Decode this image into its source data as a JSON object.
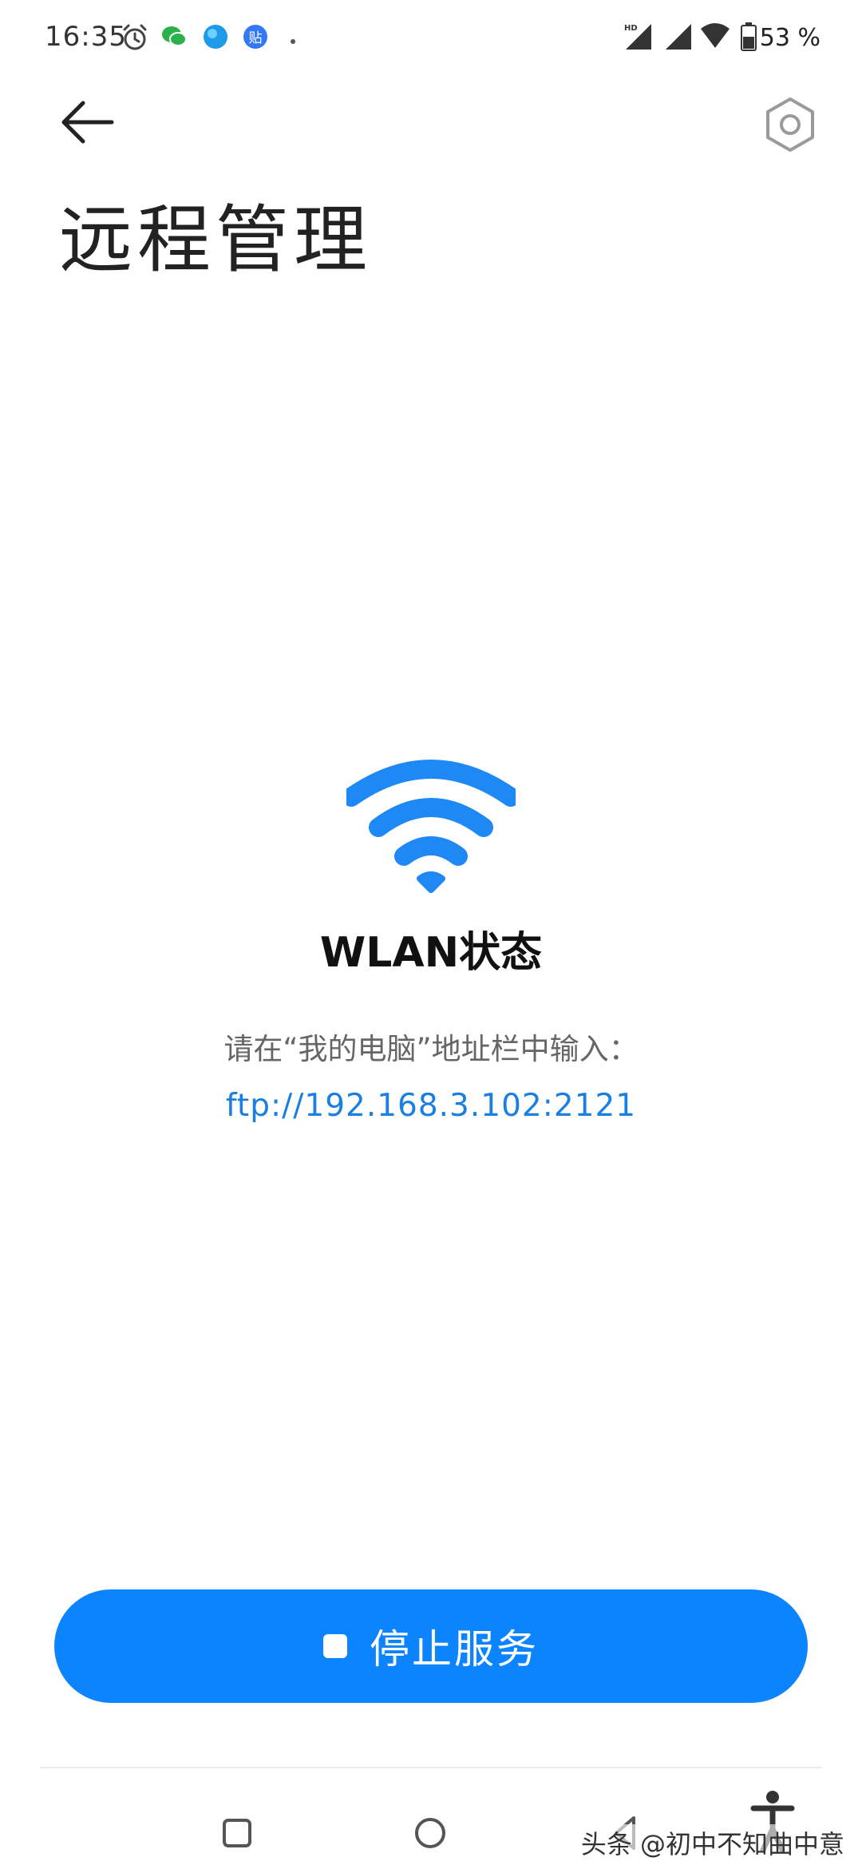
{
  "status_bar": {
    "time": "16:35",
    "battery_percent": "53 %",
    "notification_icons": [
      "alarm-icon",
      "wechat-icon",
      "browser-icon",
      "tieba-icon",
      "dot-icon"
    ],
    "system_icons": [
      "hd-signal-icon",
      "signal-icon",
      "wifi-icon",
      "battery-icon"
    ],
    "tieba_label": "贴"
  },
  "header": {
    "title": "远程管理",
    "back_icon": "arrow-left-icon",
    "settings_icon": "hexagon-settings-icon"
  },
  "main": {
    "wifi_icon": "wifi-icon",
    "status_label": "WLAN状态",
    "instruction": "请在“我的电脑”地址栏中输入：",
    "ftp_address": "ftp://192.168.3.102:2121",
    "accent_color": "#1a7fe0"
  },
  "stop_button": {
    "label": "停止服务",
    "color": "#0d84ff"
  },
  "nav_bar": {
    "items": [
      "square-recents-icon",
      "circle-home-icon",
      "triangle-back-icon"
    ],
    "accessibility_icon": "accessibility-icon"
  },
  "watermark": {
    "text": "头条 @初中不知曲中意"
  }
}
